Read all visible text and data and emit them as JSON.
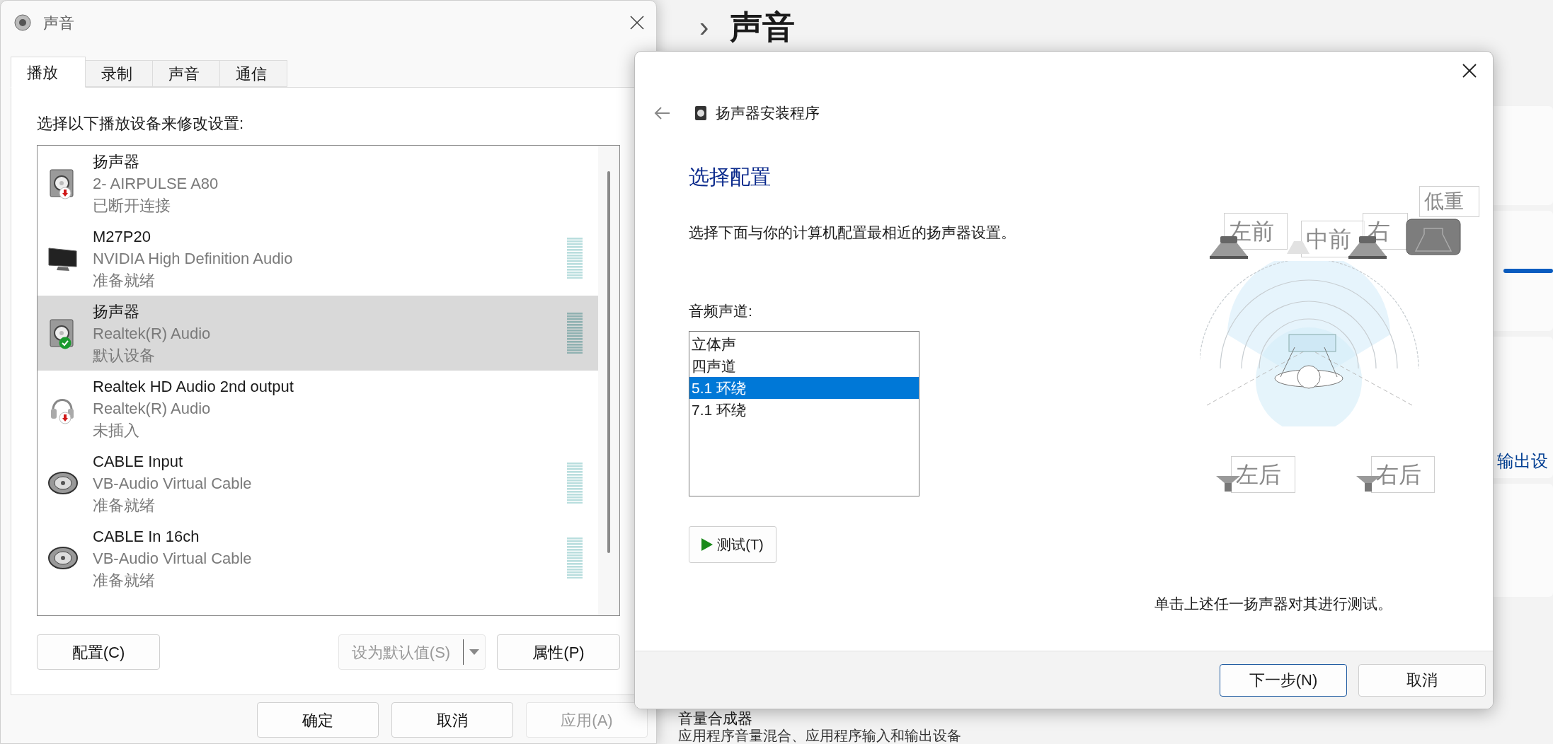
{
  "background": {
    "separator": "›",
    "title": "声音",
    "output_link": "输出设",
    "mixer": {
      "title": "音量合成器",
      "description": "应用程序音量混合、应用程序输入和输出设备"
    }
  },
  "sound_dialog": {
    "title": "声音",
    "tabs": [
      {
        "label": "播放",
        "selected": true
      },
      {
        "label": "录制",
        "selected": false
      },
      {
        "label": "声音",
        "selected": false
      },
      {
        "label": "通信",
        "selected": false
      }
    ],
    "instruction": "选择以下播放设备来修改设置:",
    "devices": [
      {
        "name": "扬声器",
        "driver": "2- AIRPULSE A80",
        "status": "已断开连接",
        "kind": "speaker",
        "unplugged": true,
        "default": false,
        "meter": false,
        "selected": false
      },
      {
        "name": "M27P20",
        "driver": "NVIDIA High Definition Audio",
        "status": "准备就绪",
        "kind": "monitor",
        "unplugged": false,
        "default": false,
        "meter": true,
        "selected": false
      },
      {
        "name": "扬声器",
        "driver": "Realtek(R) Audio",
        "status": "默认设备",
        "kind": "speaker",
        "unplugged": false,
        "default": true,
        "meter": true,
        "selected": true
      },
      {
        "name": "Realtek HD Audio 2nd output",
        "driver": "Realtek(R) Audio",
        "status": "未插入",
        "kind": "headphones",
        "unplugged": true,
        "default": false,
        "meter": false,
        "selected": false
      },
      {
        "name": "CABLE Input",
        "driver": "VB-Audio Virtual Cable",
        "status": "准备就绪",
        "kind": "cable",
        "unplugged": false,
        "default": false,
        "meter": true,
        "selected": false
      },
      {
        "name": "CABLE In 16ch",
        "driver": "VB-Audio Virtual Cable",
        "status": "准备就绪",
        "kind": "cable",
        "unplugged": false,
        "default": false,
        "meter": true,
        "selected": false
      }
    ],
    "configure_button": {
      "label": "配置(C)",
      "disabled": false
    },
    "set_default_button": {
      "label": "设为默认值(S)",
      "disabled": true
    },
    "properties_button": {
      "label": "属性(P)",
      "disabled": false
    },
    "footer_buttons": [
      {
        "label": "确定",
        "disabled": false
      },
      {
        "label": "取消",
        "disabled": false
      },
      {
        "label": "应用(A)",
        "disabled": true
      }
    ]
  },
  "setup_dialog": {
    "title": "扬声器安装程序",
    "heading": "选择配置",
    "description": "选择下面与你的计算机配置最相近的扬声器设置。",
    "channels_label": "音频声道:",
    "channels": [
      {
        "label": "立体声",
        "selected": false
      },
      {
        "label": "四声道",
        "selected": false
      },
      {
        "label": "5.1 环绕",
        "selected": true
      },
      {
        "label": "7.1 环绕",
        "selected": false
      }
    ],
    "test_button": "测试(T)",
    "speakers": [
      {
        "label": "左前",
        "kind": "front"
      },
      {
        "label": "中前",
        "kind": "center"
      },
      {
        "label": "右",
        "kind": "front"
      },
      {
        "label": "低重",
        "kind": "sub"
      },
      {
        "label": "左后",
        "kind": "rear"
      },
      {
        "label": "右后",
        "kind": "rear"
      }
    ],
    "hint": "单击上述任一扬声器对其进行测试。",
    "buttons": [
      {
        "label": "下一步(N)",
        "default": true
      },
      {
        "label": "取消",
        "default": false
      }
    ]
  }
}
